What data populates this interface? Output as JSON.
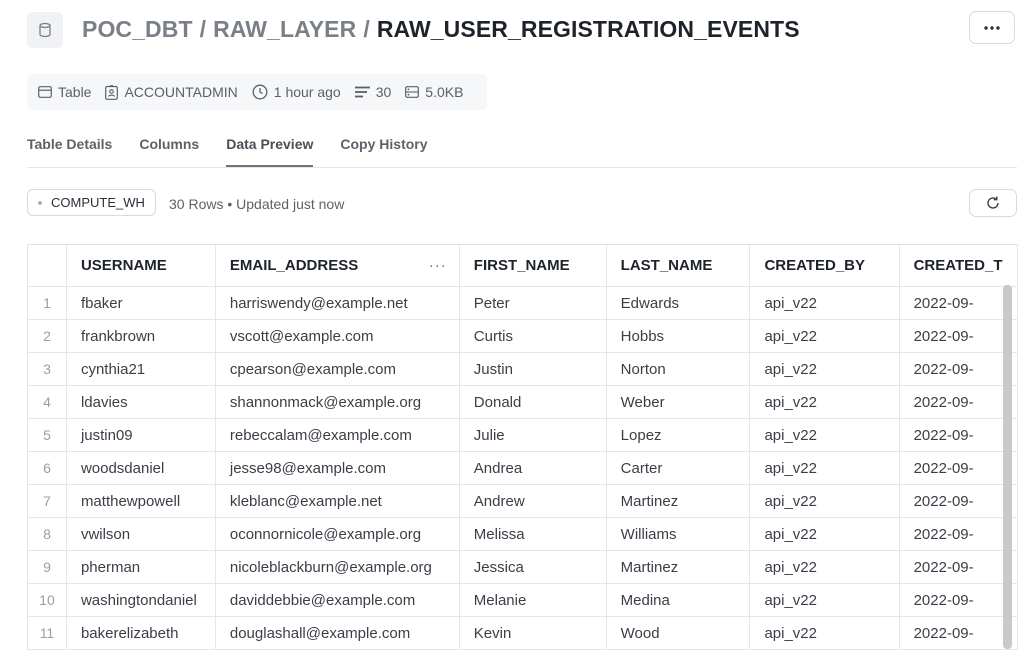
{
  "header": {
    "breadcrumb": [
      "POC_DBT",
      "RAW_LAYER",
      "RAW_USER_REGISTRATION_EVENTS"
    ],
    "separator": "/",
    "more_label": "···",
    "icon": "database-icon"
  },
  "meta": {
    "type": "Table",
    "owner": "ACCOUNTADMIN",
    "updated": "1 hour ago",
    "row_count": "30",
    "size": "5.0KB"
  },
  "tabs": [
    "Table Details",
    "Columns",
    "Data Preview",
    "Copy History"
  ],
  "active_tab": "Data Preview",
  "toolbar": {
    "warehouse": "COMPUTE_WH",
    "rows_info": "30 Rows • Updated just now"
  },
  "table": {
    "columns": [
      "USERNAME",
      "EMAIL_ADDRESS",
      "FIRST_NAME",
      "LAST_NAME",
      "CREATED_BY",
      "CREATED_T"
    ],
    "column_menu": "···",
    "rows": [
      [
        "1",
        "fbaker",
        "harriswendy@example.net",
        "Peter",
        "Edwards",
        "api_v22",
        "2022-09-"
      ],
      [
        "2",
        "frankbrown",
        "vscott@example.com",
        "Curtis",
        "Hobbs",
        "api_v22",
        "2022-09-"
      ],
      [
        "3",
        "cynthia21",
        "cpearson@example.com",
        "Justin",
        "Norton",
        "api_v22",
        "2022-09-"
      ],
      [
        "4",
        "ldavies",
        "shannonmack@example.org",
        "Donald",
        "Weber",
        "api_v22",
        "2022-09-"
      ],
      [
        "5",
        "justin09",
        "rebeccalam@example.com",
        "Julie",
        "Lopez",
        "api_v22",
        "2022-09-"
      ],
      [
        "6",
        "woodsdaniel",
        "jesse98@example.com",
        "Andrea",
        "Carter",
        "api_v22",
        "2022-09-"
      ],
      [
        "7",
        "matthewpowell",
        "kleblanc@example.net",
        "Andrew",
        "Martinez",
        "api_v22",
        "2022-09-"
      ],
      [
        "8",
        "vwilson",
        "oconnornicole@example.org",
        "Melissa",
        "Williams",
        "api_v22",
        "2022-09-"
      ],
      [
        "9",
        "pherman",
        "nicoleblackburn@example.org",
        "Jessica",
        "Martinez",
        "api_v22",
        "2022-09-"
      ],
      [
        "10",
        "washingtondaniel",
        "daviddebbie@example.com",
        "Melanie",
        "Medina",
        "api_v22",
        "2022-09-"
      ],
      [
        "11",
        "bakerelizabeth",
        "douglashall@example.com",
        "Kevin",
        "Wood",
        "api_v22",
        "2022-09-"
      ]
    ]
  }
}
